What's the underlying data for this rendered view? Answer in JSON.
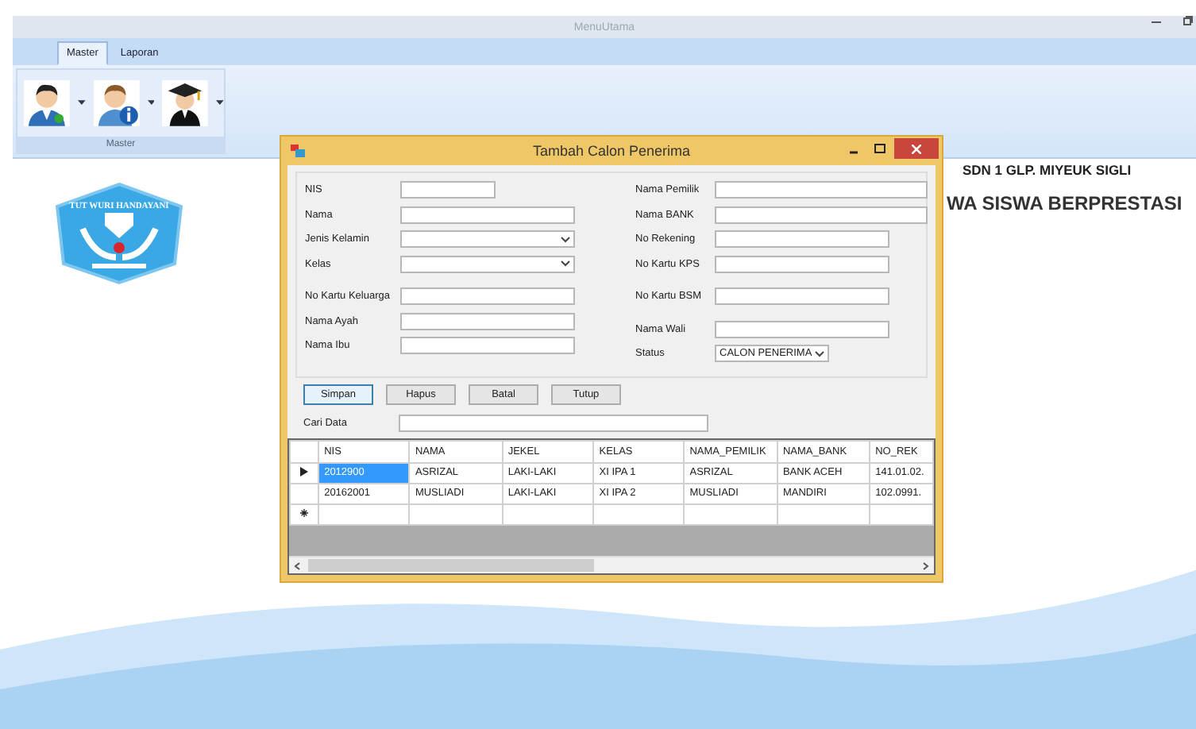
{
  "window": {
    "title": "MenuUtama"
  },
  "ribbon": {
    "tabs": [
      {
        "label": "Master",
        "selected": true
      },
      {
        "label": "Laporan",
        "selected": false
      }
    ],
    "group_label": "Master"
  },
  "logo": {
    "text": "TUT WURI HANDAYANI"
  },
  "school": {
    "name": "SDN 1 GLP. MIYEUK SIGLI",
    "heading": "WA SISWA BERPRESTASI"
  },
  "dialog": {
    "title": "Tambah Calon Penerima",
    "left_fields": [
      {
        "label": "NIS",
        "kind": "short"
      },
      {
        "label": "Nama",
        "kind": "text"
      },
      {
        "label": "Jenis Kelamin",
        "kind": "combo"
      },
      {
        "label": "Kelas",
        "kind": "combo"
      },
      {
        "label": "No Kartu Keluarga",
        "kind": "text"
      },
      {
        "label": "Nama Ayah",
        "kind": "text"
      },
      {
        "label": "Nama Ibu",
        "kind": "text"
      }
    ],
    "right_fields": [
      {
        "label": "Nama Pemilik",
        "kind": "wide"
      },
      {
        "label": "Nama BANK",
        "kind": "wide"
      },
      {
        "label": "No Rekening",
        "kind": "text"
      },
      {
        "label": "No Kartu KPS",
        "kind": "text"
      },
      {
        "label": "No Kartu BSM",
        "kind": "text"
      },
      {
        "label": "Nama Wali",
        "kind": "text"
      },
      {
        "label": "Status",
        "kind": "combo",
        "value": "CALON PENERIMA"
      }
    ],
    "buttons": [
      {
        "label": "Simpan",
        "focused": true
      },
      {
        "label": "Hapus",
        "focused": false
      },
      {
        "label": "Batal",
        "focused": false
      },
      {
        "label": "Tutup",
        "focused": false
      }
    ],
    "search": {
      "label": "Cari Data"
    },
    "table": {
      "columns": [
        "NIS",
        "NAMA",
        "JEKEL",
        "KELAS",
        "NAMA_PEMILIK",
        "NAMA_BANK",
        "NO_REK"
      ],
      "rows": [
        {
          "selected": true,
          "cells": [
            "2012900",
            "ASRIZAL",
            "LAKI-LAKI",
            "XI IPA 1",
            "ASRIZAL",
            "BANK ACEH",
            "141.01.02."
          ]
        },
        {
          "selected": false,
          "cells": [
            "20162001",
            "MUSLIADI",
            "LAKI-LAKI",
            "XI IPA 2",
            "MUSLIADI",
            "MANDIRI",
            "102.0991."
          ]
        }
      ]
    }
  }
}
